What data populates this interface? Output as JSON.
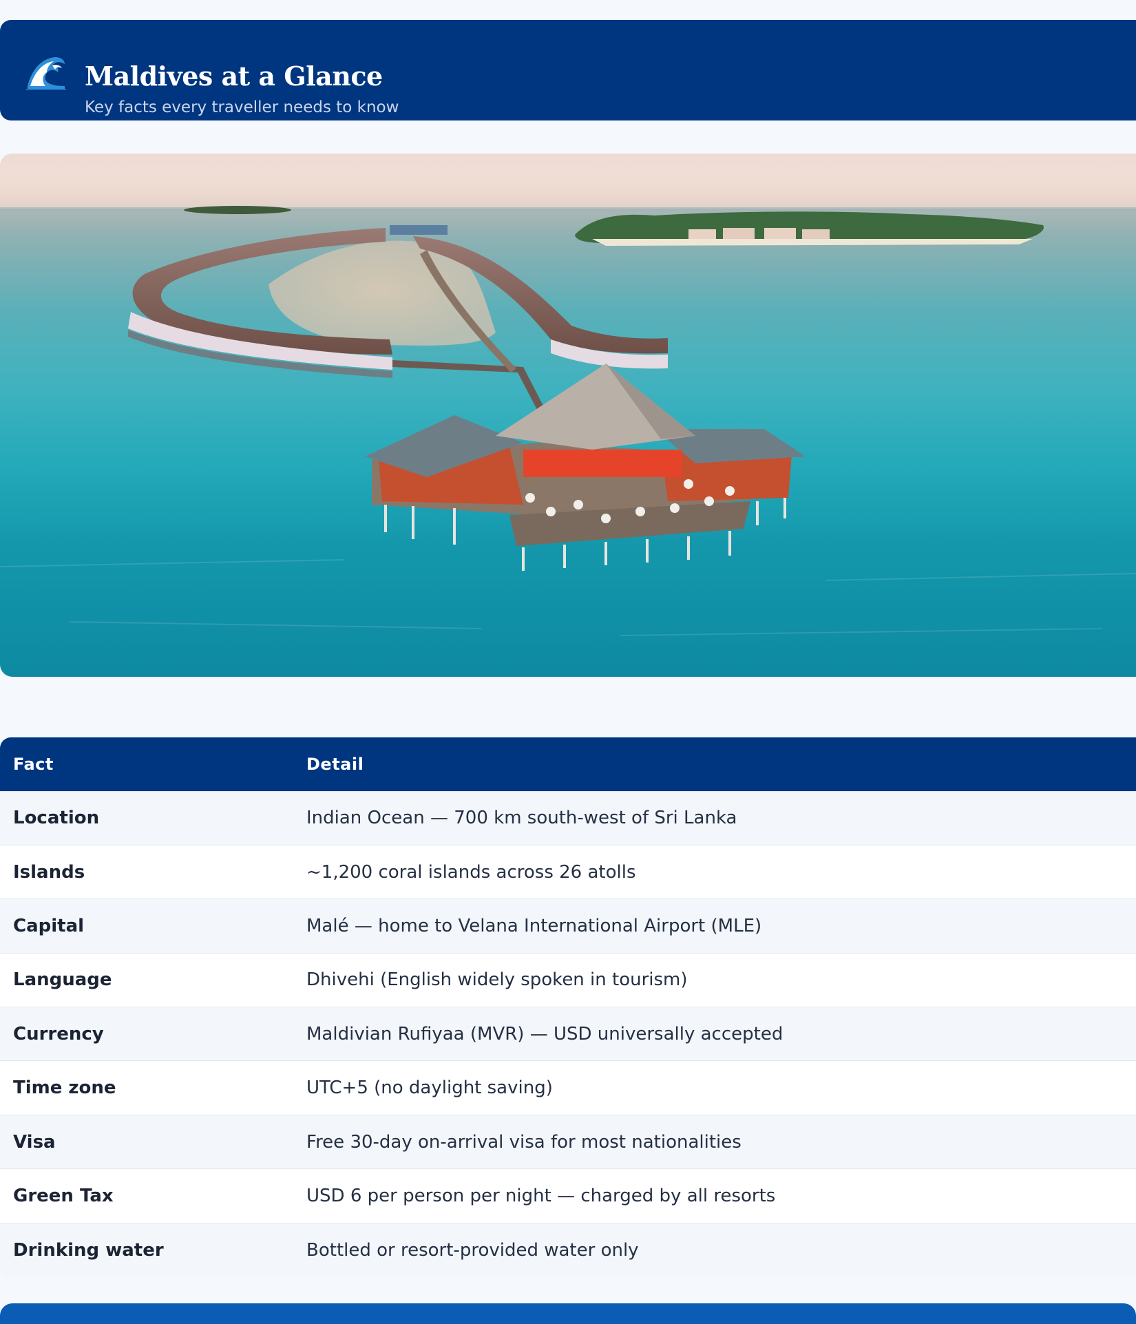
{
  "header": {
    "icon": "wave-icon",
    "title": "Maldives at a Glance",
    "subtitle": "Key facts every traveller needs to know"
  },
  "hero": {
    "description_icon": "resort-photo"
  },
  "table": {
    "columns": [
      "Fact",
      "Detail"
    ],
    "rows": [
      {
        "fact": "Location",
        "detail": "Indian Ocean — 700 km south-west of Sri Lanka"
      },
      {
        "fact": "Islands",
        "detail": "~1,200 coral islands across 26 atolls"
      },
      {
        "fact": "Capital",
        "detail": "Malé — home to Velana International Airport (MLE)"
      },
      {
        "fact": "Language",
        "detail": "Dhivehi (English widely spoken in tourism)"
      },
      {
        "fact": "Currency",
        "detail": "Maldivian Rufiyaa (MVR) — USD universally accepted"
      },
      {
        "fact": "Time zone",
        "detail": "UTC+5 (no daylight saving)"
      },
      {
        "fact": "Visa",
        "detail": "Free 30-day on-arrival visa for most nationalities"
      },
      {
        "fact": "Green Tax",
        "detail": "USD 6 per person per night — charged by all resorts"
      },
      {
        "fact": "Drinking water",
        "detail": "Bottled or resort-provided water only"
      }
    ]
  },
  "colors": {
    "brand": "#003580",
    "row_alt": "#f3f6fa",
    "accent_bottom": "#0a5cb5"
  }
}
